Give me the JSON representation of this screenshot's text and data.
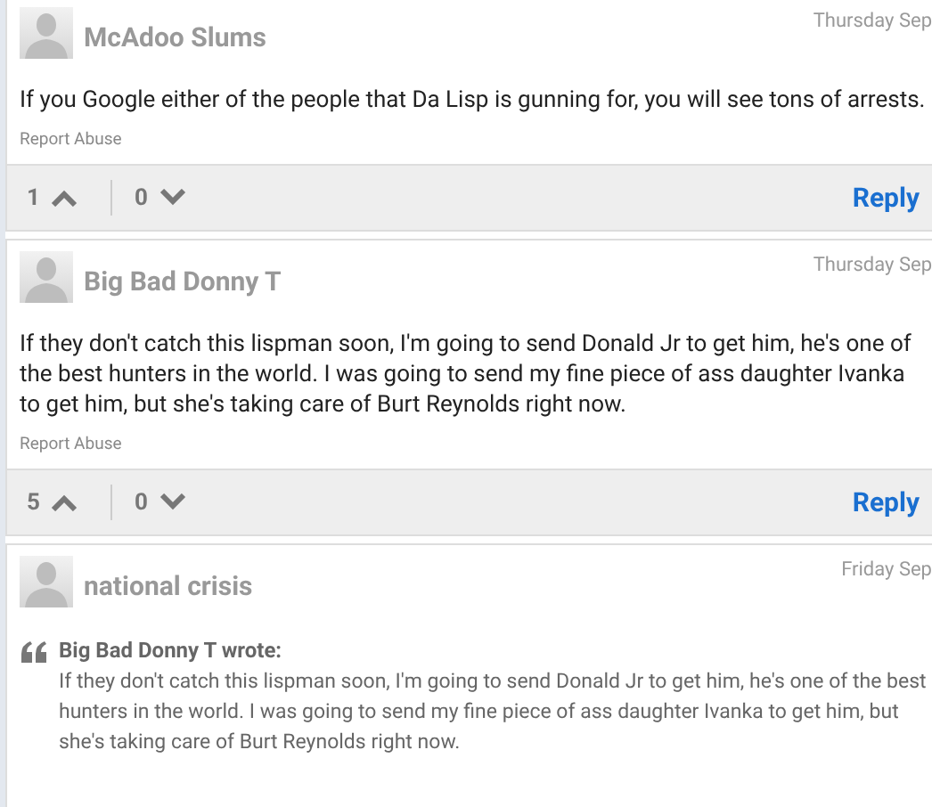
{
  "comments": [
    {
      "author": "McAdoo Slums",
      "date": "Thursday Sep",
      "body": "If you Google either of the people that Da Lisp is gunning for, you will see tons of arrests.",
      "report": "Report Abuse",
      "upvotes": "1",
      "downvotes": "0",
      "reply": "Reply"
    },
    {
      "author": "Big Bad Donny T",
      "date": "Thursday Sep",
      "body": "If they don't catch this lispman soon, I'm going to send Donald Jr to get him, he's one of the best hunters in the world. I was going to send my fine piece of ass daughter Ivanka to get him, but she's taking care of Burt Reynolds right now.",
      "report": "Report Abuse",
      "upvotes": "5",
      "downvotes": "0",
      "reply": "Reply"
    },
    {
      "author": "national crisis",
      "date": "Friday Sep",
      "quote": {
        "author": "Big Bad Donny T wrote:",
        "text": "If they don't catch this lispman soon, I'm going to send Donald Jr to get him, he's one of the best hunters in the world. I was going to send my fine piece of ass daughter Ivanka to get him, but she's taking care of Burt Reynolds right now."
      }
    }
  ]
}
